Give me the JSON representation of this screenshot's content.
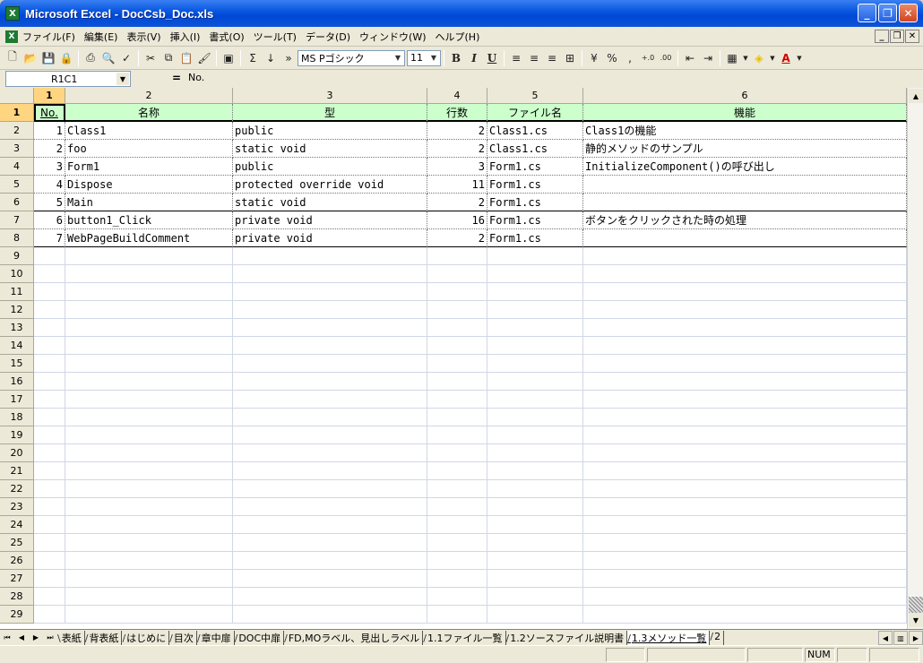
{
  "window": {
    "title": "Microsoft Excel - DocCsb_Doc.xls",
    "app_icon": "excel-icon",
    "min_label": "_",
    "max_label": "❐",
    "close_label": "✕"
  },
  "menu": {
    "items": [
      "ファイル(F)",
      "編集(E)",
      "表示(V)",
      "挿入(I)",
      "書式(O)",
      "ツール(T)",
      "データ(D)",
      "ウィンドウ(W)",
      "ヘルプ(H)"
    ],
    "mdi_min": "_",
    "mdi_restore": "❐",
    "mdi_close": "✕"
  },
  "toolbar": {
    "font_name": "MS Pゴシック",
    "font_size": "11",
    "bold": "B",
    "italic": "I",
    "underline": "U",
    "sum": "Σ",
    "percent": "%",
    "comma": ",",
    "inc_decimal": "+.0",
    "dec_decimal": ".00"
  },
  "formula_bar": {
    "name_box": "R1C1",
    "equals": "=",
    "content": "No."
  },
  "columns": [
    "1",
    "2",
    "3",
    "4",
    "5",
    "6"
  ],
  "header_row": [
    "No.",
    "名称",
    "型",
    "行数",
    "ファイル名",
    "機能"
  ],
  "rows": [
    {
      "no": "1",
      "name": "Class1",
      "type": "public",
      "lines": "2",
      "file": "Class1.cs",
      "func": "Class1の機能"
    },
    {
      "no": "2",
      "name": "foo",
      "type": "static void",
      "lines": "2",
      "file": "Class1.cs",
      "func": "静的メソッドのサンプル"
    },
    {
      "no": "3",
      "name": "Form1",
      "type": "public",
      "lines": "3",
      "file": "Form1.cs",
      "func": "InitializeComponent()の呼び出し"
    },
    {
      "no": "4",
      "name": "Dispose",
      "type": "protected override void",
      "lines": "11",
      "file": "Form1.cs",
      "func": ""
    },
    {
      "no": "5",
      "name": "Main",
      "type": "static void",
      "lines": "2",
      "file": "Form1.cs",
      "func": ""
    },
    {
      "no": "6",
      "name": "button1_Click",
      "type": "private void",
      "lines": "16",
      "file": "Form1.cs",
      "func": "ボタンをクリックされた時の処理"
    },
    {
      "no": "7",
      "name": "WebPageBuildComment",
      "type": "private void",
      "lines": "2",
      "file": "Form1.cs",
      "func": ""
    }
  ],
  "row_numbers": [
    "1",
    "2",
    "3",
    "4",
    "5",
    "6",
    "7",
    "8",
    "9",
    "10",
    "11",
    "12",
    "13",
    "14",
    "15",
    "16",
    "17",
    "18",
    "19",
    "20",
    "21",
    "22",
    "23",
    "24",
    "25",
    "26",
    "27",
    "28",
    "29"
  ],
  "sheet_tabs": [
    "表紙",
    "背表紙",
    "はじめに",
    "目次",
    "章中扉",
    "DOC中扉",
    "FD,MOラベル、見出しラベル",
    "1.1ファイル一覧",
    "1.2ソースファイル説明書",
    "1.3メソッド一覧",
    "2"
  ],
  "active_sheet": "1.3メソッド一覧",
  "status": {
    "num": "NUM"
  }
}
